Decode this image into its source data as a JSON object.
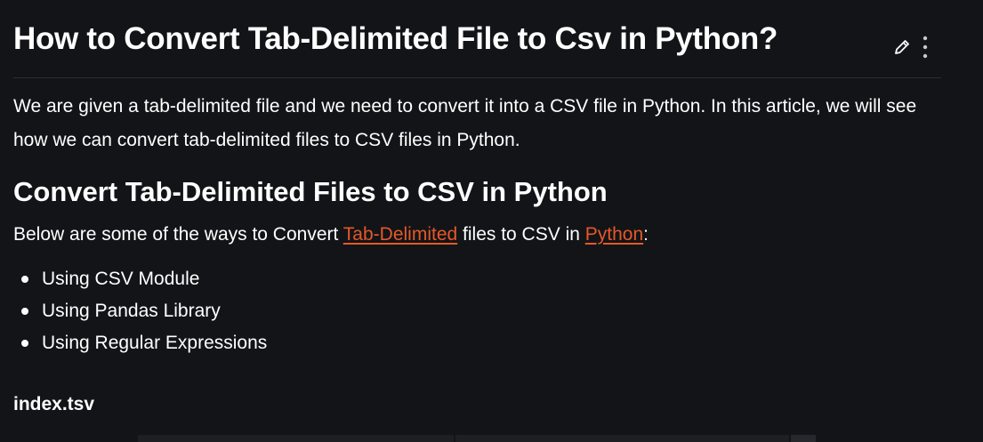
{
  "article": {
    "title": "How to Convert Tab-Delimited File to Csv in Python?",
    "intro": "We are given a tab-delimited file and we need to convert it into a CSV file in Python. In this article, we will see how we can convert tab-delimited files to CSV files in Python.",
    "section_heading": "Convert Tab-Delimited Files to CSV in Python",
    "ways": {
      "prefix": "Below are some of the ways to Convert ",
      "link1": "Tab-Delimited",
      "middle": " files to CSV in ",
      "link2": "Python",
      "suffix": ":"
    },
    "methods": [
      "Using CSV Module",
      "Using Pandas Library",
      "Using Regular Expressions"
    ],
    "file_label": "index.tsv"
  },
  "icons": {
    "edit": "pencil-icon",
    "more": "vertical-dots-icon"
  },
  "colors": {
    "background": "#131417",
    "text": "#ffffff",
    "link": "#e5582a",
    "divider": "#2a2c31"
  }
}
